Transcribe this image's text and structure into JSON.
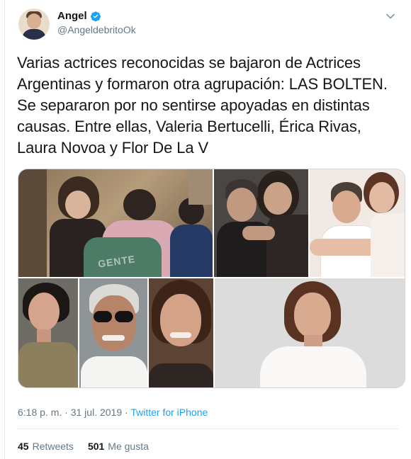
{
  "tweet": {
    "author": {
      "display_name": "Angel",
      "handle": "@AngeldebritoOk",
      "verified": true
    },
    "text": "Varias actrices reconocidas se bajaron de Actrices Argentinas y formaron otra agrupación: LAS BOLTEN. Se separaron por no sentirse apoyadas en distintas causas. Entre ellas, Valeria Bertucelli, Érica Rivas, Laura Novoa y Flor De La V",
    "media": {
      "photo_count": 7,
      "watermark": "GENTE"
    },
    "meta": {
      "time": "6:18 p. m.",
      "separator1": " · ",
      "date": "31 jul. 2019",
      "separator2": " · ",
      "source": "Twitter for iPhone"
    },
    "stats": {
      "retweets_count": "45",
      "retweets_label": "Retweets",
      "likes_count": "501",
      "likes_label": "Me gusta"
    }
  },
  "icons": {
    "verified": "verified-badge-icon",
    "menu": "chevron-down-icon"
  },
  "colors": {
    "verified_blue": "#1da1f2",
    "secondary_text": "#657786",
    "primary_text": "#14171a",
    "border": "#e6ecf0"
  }
}
